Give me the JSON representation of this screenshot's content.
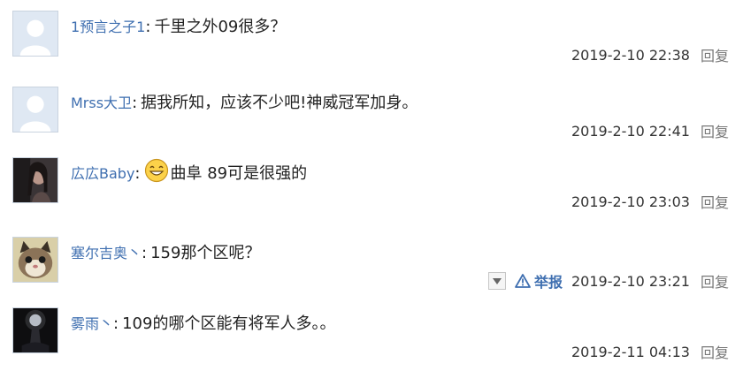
{
  "comments": [
    {
      "user": "1预言之子1",
      "text": "千里之外09很多？",
      "time": "2019-2-10 22:38",
      "reply": "回复"
    },
    {
      "user": "Mrss大卫",
      "text": "据我所知，应该不少吧!神威冠军加身。",
      "time": "2019-2-10 22:41",
      "reply": "回复"
    },
    {
      "user": "広広Baby",
      "text": "曲阜 89可是很强的",
      "time": "2019-2-10 23:03",
      "reply": "回复"
    },
    {
      "user": "塞尔吉奥丶",
      "text": "159那个区呢？",
      "time": "2019-2-10 23:21",
      "reply": "回复",
      "report": "举报"
    },
    {
      "user": "雾雨丶",
      "text": "109的哪个区能有将军人多。。",
      "time": "2019-2-11 04:13",
      "reply": "回复"
    }
  ],
  "icons": {
    "default_avatar": "default-user-icon",
    "emoji": "smile-emoji-icon",
    "report": "warning-triangle-icon",
    "dropdown": "chevron-down-icon"
  },
  "colors": {
    "username": "#3f6fb0",
    "avatar_bg": "#dfe8f3",
    "reply": "#777777"
  }
}
